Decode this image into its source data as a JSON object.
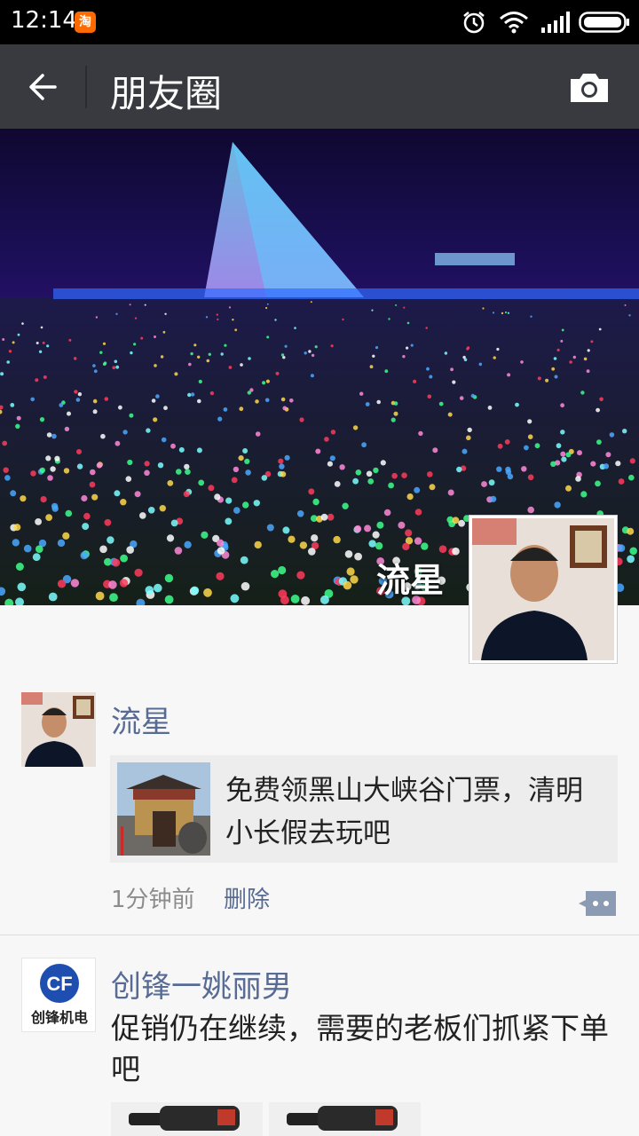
{
  "status_bar": {
    "time": "12:14",
    "app_badge": "淘"
  },
  "nav": {
    "title": "朋友圈"
  },
  "cover": {
    "owner_name": "流星"
  },
  "posts": [
    {
      "author": "流星",
      "share_text": "免费领黑山大峡谷门票，清明小长假去玩吧",
      "time": "1分钟前",
      "delete_label": "删除"
    },
    {
      "author": "创锋一姚丽男",
      "text": "促销仍在继续，需要的老板们抓紧下单吧",
      "avatar_logo": "CF",
      "avatar_caption": "创锋机电"
    }
  ]
}
